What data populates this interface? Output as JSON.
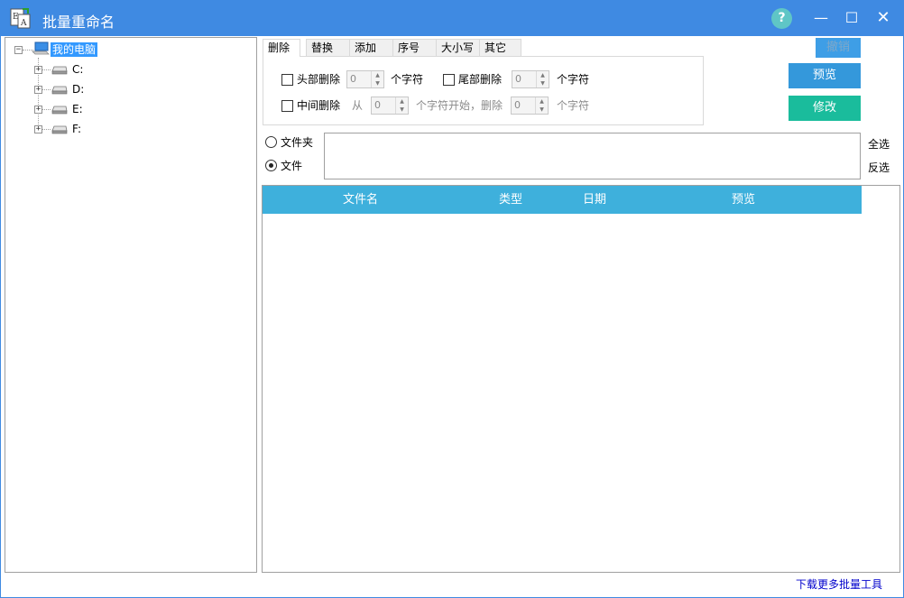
{
  "window": {
    "title": "批量重命名",
    "help_label": "?",
    "minimize_label": "—",
    "maximize_label": "☐",
    "close_label": "✕"
  },
  "tree": {
    "root_label": "我的电脑",
    "drives": [
      "C:",
      "D:",
      "E:",
      "F:"
    ]
  },
  "tabs": {
    "items": [
      "删除",
      "替换",
      "添加",
      "序号",
      "大小写",
      "其它"
    ],
    "active_index": 0
  },
  "delete_options": {
    "head_delete_label": "头部删除",
    "head_delete_value": "0",
    "head_delete_unit": "个字符",
    "tail_delete_label": "尾部删除",
    "tail_delete_value": "0",
    "tail_delete_unit": "个字符",
    "middle_delete_label": "中间删除",
    "middle_from_label": "从",
    "middle_from_value": "0",
    "middle_start_text": "个字符开始，删除",
    "middle_count_value": "0",
    "middle_count_unit": "个字符"
  },
  "actions": {
    "undo_label": "撤销",
    "preview_label": "预览",
    "modify_label": "修改"
  },
  "mode": {
    "folder_label": "文件夹",
    "file_label": "文件",
    "selected": "file"
  },
  "selection": {
    "select_all_label": "全选",
    "invert_label": "反选"
  },
  "list": {
    "columns": [
      "文件名",
      "类型",
      "日期",
      "预览"
    ],
    "rows": []
  },
  "footer": {
    "download_link": "下载更多批量工具"
  },
  "colors": {
    "titlebar": "#3f8ae2",
    "preview_button": "#3498db",
    "modify_button": "#1abc9c",
    "list_header": "#3eb0dc"
  }
}
